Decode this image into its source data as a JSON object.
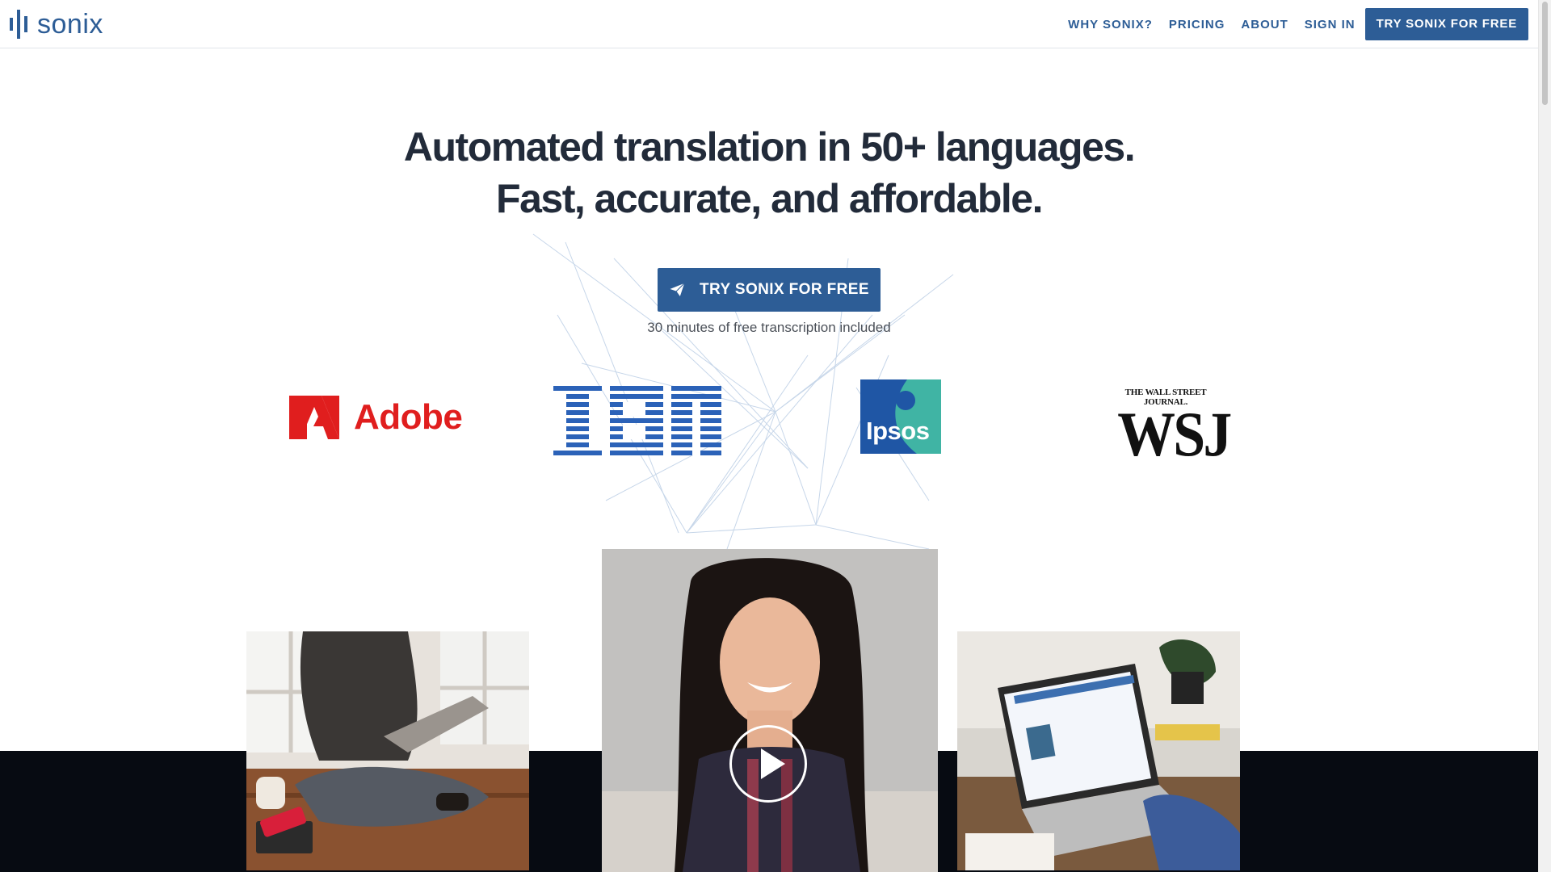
{
  "nav": {
    "logo_text": "sonix",
    "links": [
      "WHY SONIX?",
      "PRICING",
      "ABOUT",
      "SIGN IN"
    ],
    "cta_label": "TRY SONIX FOR FREE"
  },
  "hero": {
    "title_line1": "Automated translation in 50+ languages.",
    "title_line2": "Fast, accurate, and affordable.",
    "cta_label": "TRY SONIX FOR FREE",
    "cta_note": "30 minutes of free transcription included"
  },
  "logos": {
    "adobe": "Adobe",
    "ibm": "IBM",
    "ipsos": "Ipsos",
    "wsj_small": "THE WALL STREET JOURNAL.",
    "wsj_big": "WSJ"
  },
  "colors": {
    "brand_blue": "#2d5d96",
    "adobe_red": "#e01e1e",
    "ibm_blue": "#2b62b8",
    "ipsos_blue": "#1f56a5",
    "ipsos_teal": "#40b4a4",
    "dark_band": "#070b12"
  },
  "icons": {
    "cta": "paper-plane-icon",
    "video": "play-icon"
  }
}
